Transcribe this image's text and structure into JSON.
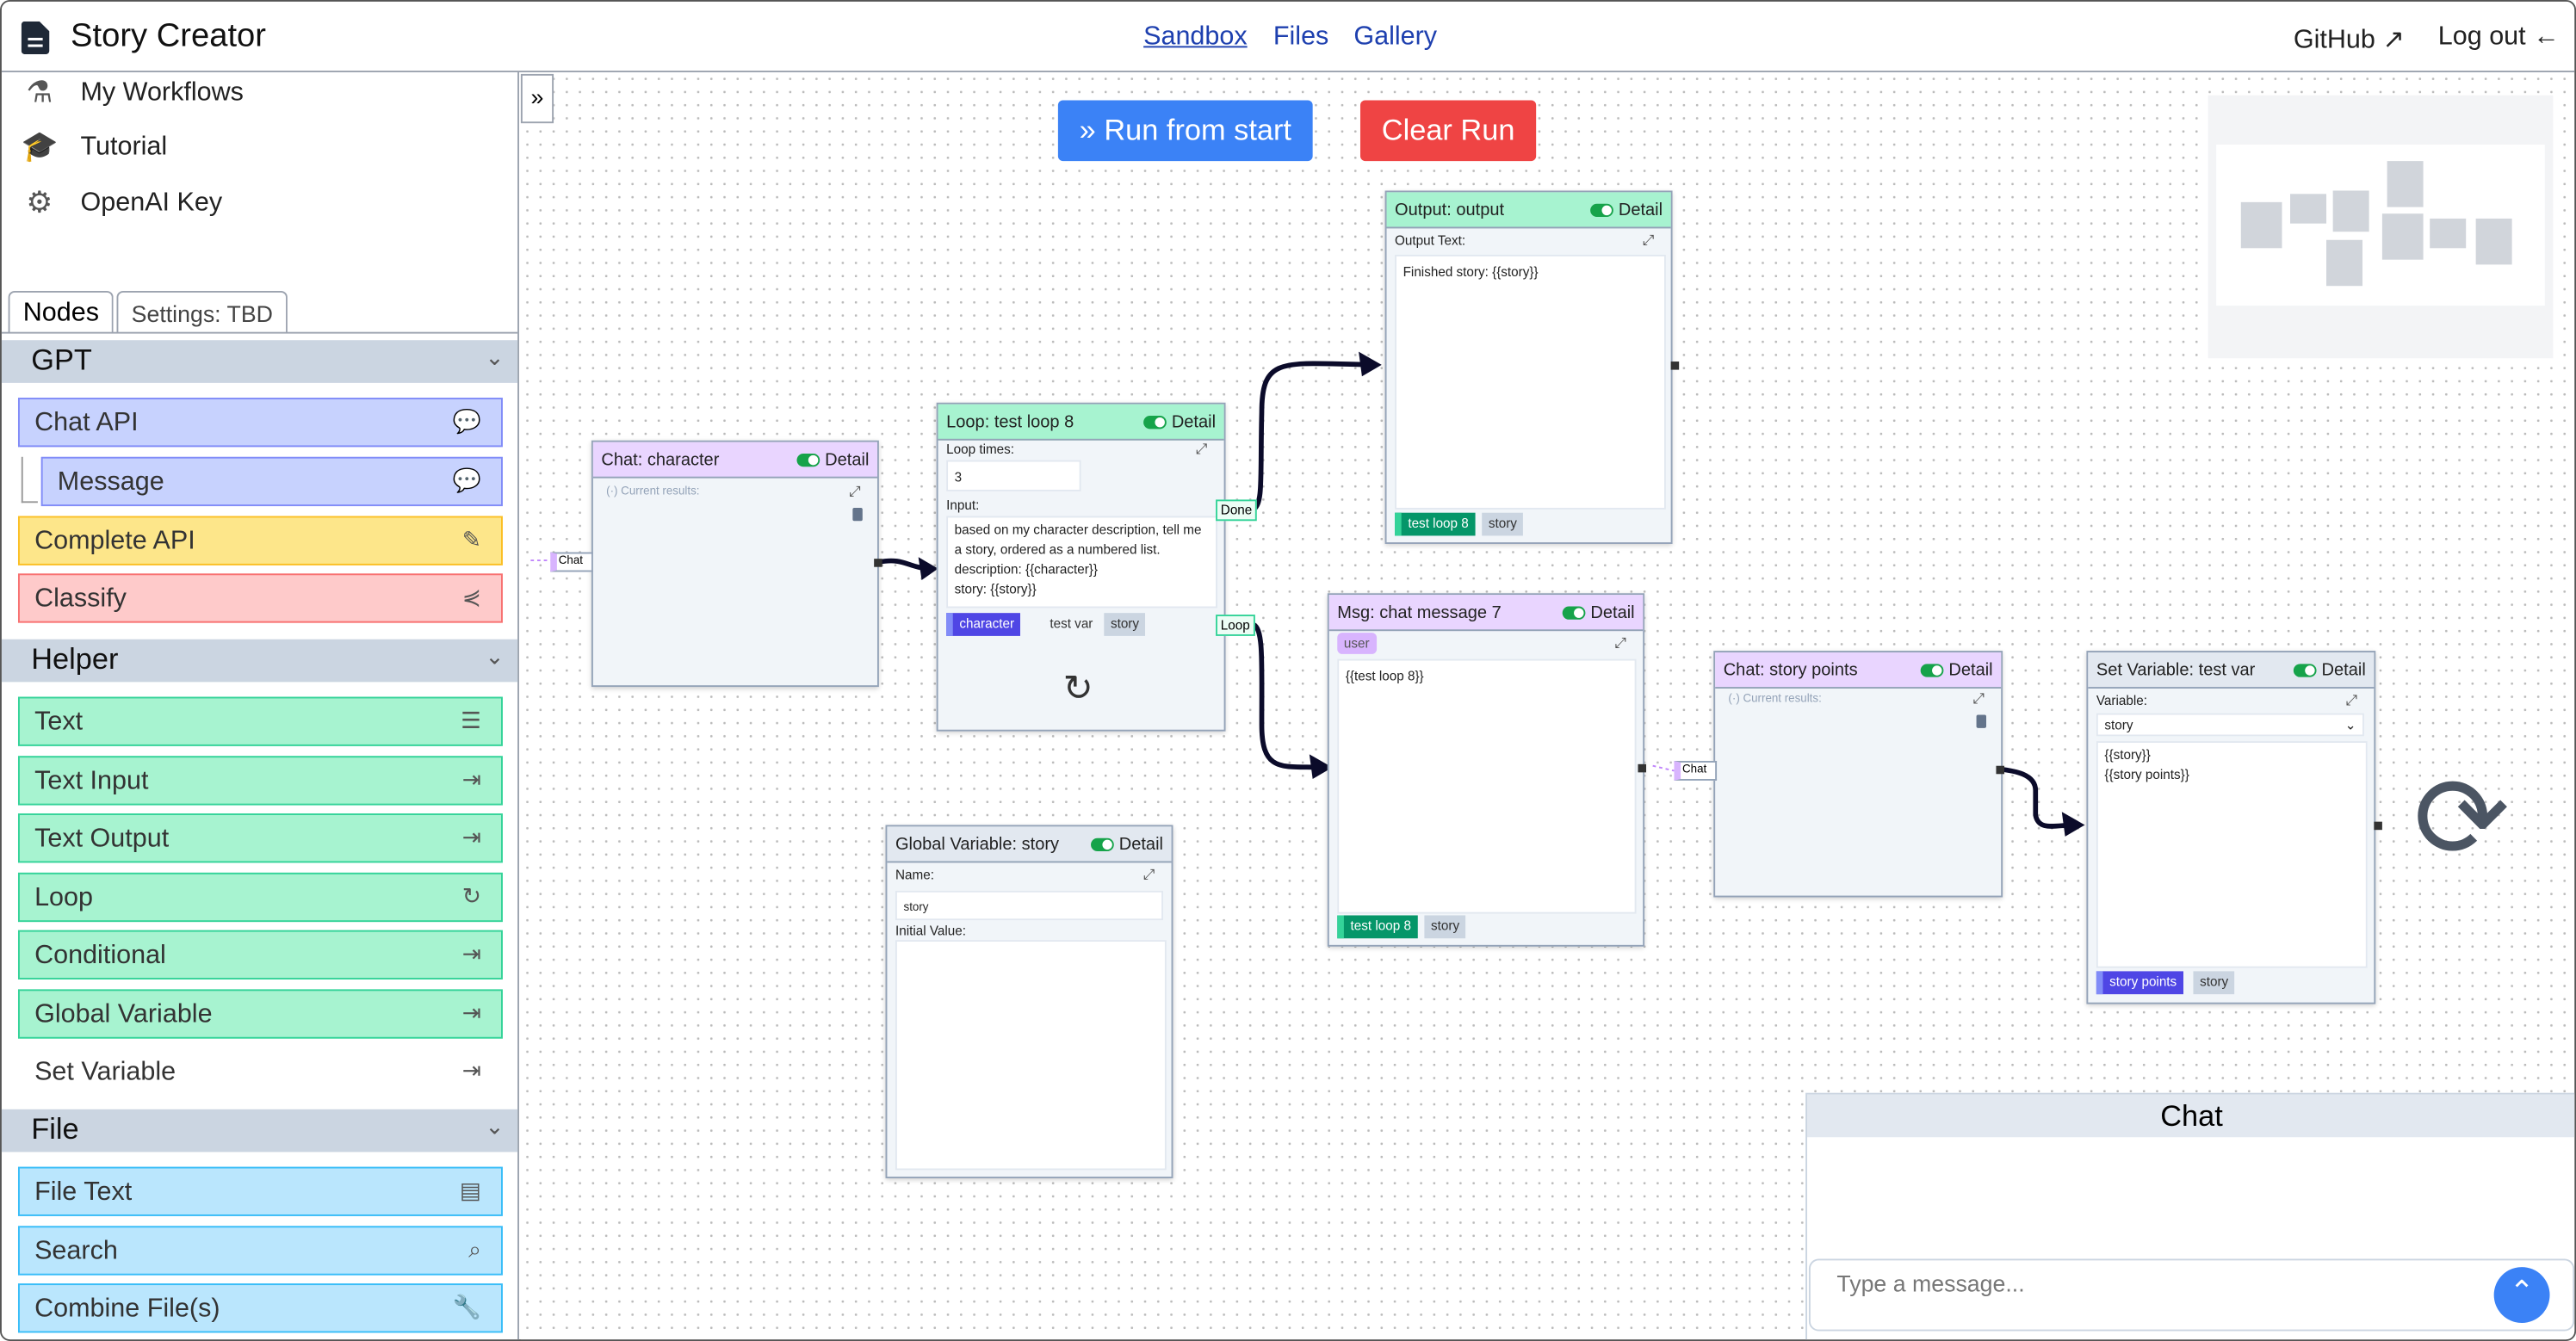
{
  "app": {
    "title": "Story Creator",
    "icon": "document-icon"
  },
  "nav": {
    "links": [
      "Sandbox",
      "Files",
      "Gallery"
    ],
    "active": "Sandbox",
    "github": "GitHub",
    "logout": "Log out"
  },
  "sidebar": {
    "menu": [
      {
        "label": "My Workflows",
        "icon": "flask-icon"
      },
      {
        "label": "Tutorial",
        "icon": "graduation-cap-icon"
      },
      {
        "label": "OpenAI Key",
        "icon": "gear-icon"
      }
    ],
    "tabs": [
      "Nodes",
      "Settings: TBD"
    ],
    "sections": [
      {
        "title": "GPT",
        "items": [
          {
            "label": "Chat API",
            "icon": "comments-icon"
          },
          {
            "label": "Message",
            "icon": "comment-icon"
          },
          {
            "label": "Complete API",
            "icon": "pencil-icon"
          },
          {
            "label": "Classify",
            "icon": "share-icon"
          }
        ]
      },
      {
        "title": "Helper",
        "items": [
          {
            "label": "Text",
            "icon": "align-icon"
          },
          {
            "label": "Text Input",
            "icon": "sign-in-icon"
          },
          {
            "label": "Text Output",
            "icon": "sign-out-icon"
          },
          {
            "label": "Loop",
            "icon": "refresh-icon"
          },
          {
            "label": "Conditional",
            "icon": "sign-out-icon"
          },
          {
            "label": "Global Variable",
            "icon": "sign-out-icon"
          },
          {
            "label": "Set Variable",
            "icon": "sign-out-icon"
          }
        ]
      },
      {
        "title": "File",
        "items": [
          {
            "label": "File Text",
            "icon": "file-icon"
          },
          {
            "label": "Search",
            "icon": "search-icon"
          },
          {
            "label": "Combine File(s)",
            "icon": "wrench-icon"
          }
        ]
      }
    ]
  },
  "toolbar": {
    "run": "Run from start",
    "clear": "Clear Run"
  },
  "colors": {
    "run": "#3b82f6",
    "clear": "#ef4444",
    "chat_header": "#e9d5ff",
    "helper_header": "#a7f3d0",
    "var_header": "#e2e8f0"
  },
  "nodes": {
    "chat_character": {
      "title": "Chat: character",
      "detail": "Detail",
      "results": "(·) Current results:",
      "input_tag": "Chat"
    },
    "loop": {
      "title": "Loop: test loop 8",
      "detail": "Detail",
      "times_label": "Loop times:",
      "times": "3",
      "input_label": "Input:",
      "input": "based on my character description, tell me a story, ordered as a numbered list.\ndescription: {{character}}\nstory: {{story}}",
      "chips": [
        "character",
        "test var",
        "story"
      ],
      "done": "Done",
      "loop": "Loop"
    },
    "output": {
      "title": "Output: output",
      "detail": "Detail",
      "label": "Output Text:",
      "text": "Finished story: {{story}}",
      "chips": [
        "test loop 8",
        "story"
      ]
    },
    "msg": {
      "title": "Msg: chat message 7",
      "detail": "Detail",
      "role": "user",
      "text": "{{test loop 8}}",
      "chips": [
        "test loop 8",
        "story"
      ]
    },
    "chat_points": {
      "title": "Chat: story points",
      "detail": "Detail",
      "results": "(·) Current results:",
      "input_tag": "Chat"
    },
    "setvar": {
      "title": "Set Variable: test var",
      "detail": "Detail",
      "label": "Variable:",
      "value": "story",
      "text": "{{story}}\n{{story points}}",
      "chips": [
        "story points",
        "story"
      ]
    },
    "globalvar": {
      "title": "Global Variable: story",
      "detail": "Detail",
      "name_label": "Name:",
      "name": "story",
      "init_label": "Initial Value:"
    }
  },
  "chat_panel": {
    "title": "Chat",
    "placeholder": "Type a message..."
  }
}
